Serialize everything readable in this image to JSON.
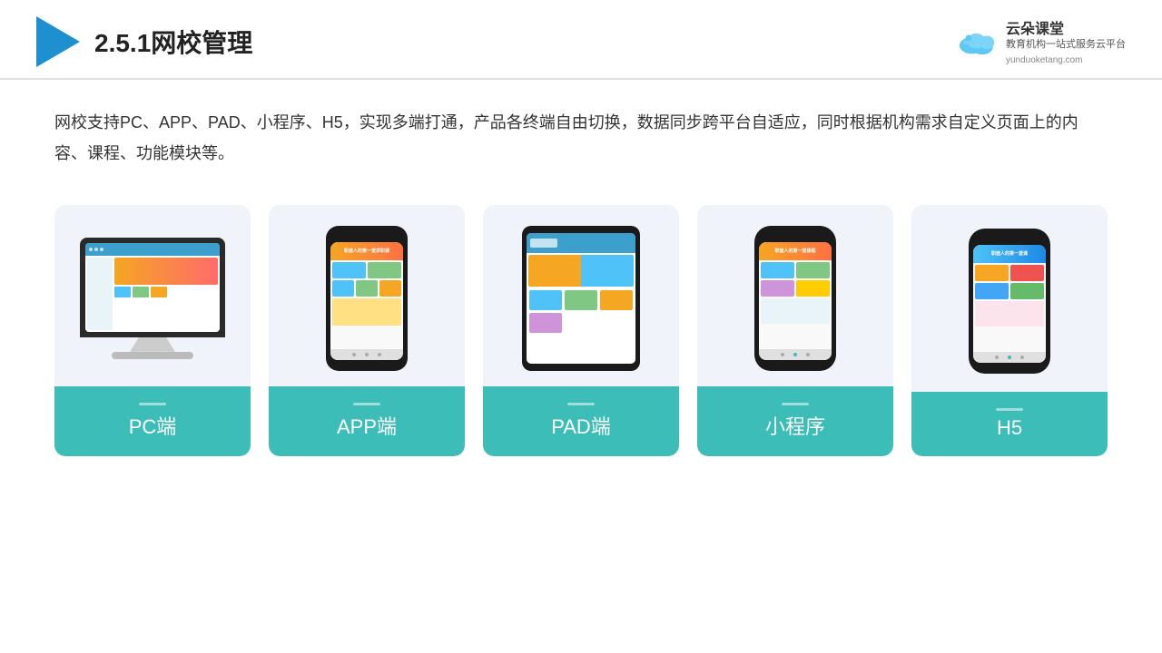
{
  "header": {
    "title": "2.5.1网校管理",
    "brand": {
      "name": "云朵课堂",
      "url": "yunduoketang.com",
      "tagline": "教育机构一站式服务云平台"
    }
  },
  "description": "网校支持PC、APP、PAD、小程序、H5，实现多端打通，产品各终端自由切换，数据同步跨平台自适应，同时根据机构需求自定义页面上的内容、课程、功能模块等。",
  "cards": [
    {
      "id": "pc",
      "label": "PC端"
    },
    {
      "id": "app",
      "label": "APP端"
    },
    {
      "id": "pad",
      "label": "PAD端"
    },
    {
      "id": "miniprogram",
      "label": "小程序"
    },
    {
      "id": "h5",
      "label": "H5"
    }
  ],
  "colors": {
    "accent": "#3dbdb8",
    "primary": "#1e90d0",
    "titleColor": "#222"
  }
}
